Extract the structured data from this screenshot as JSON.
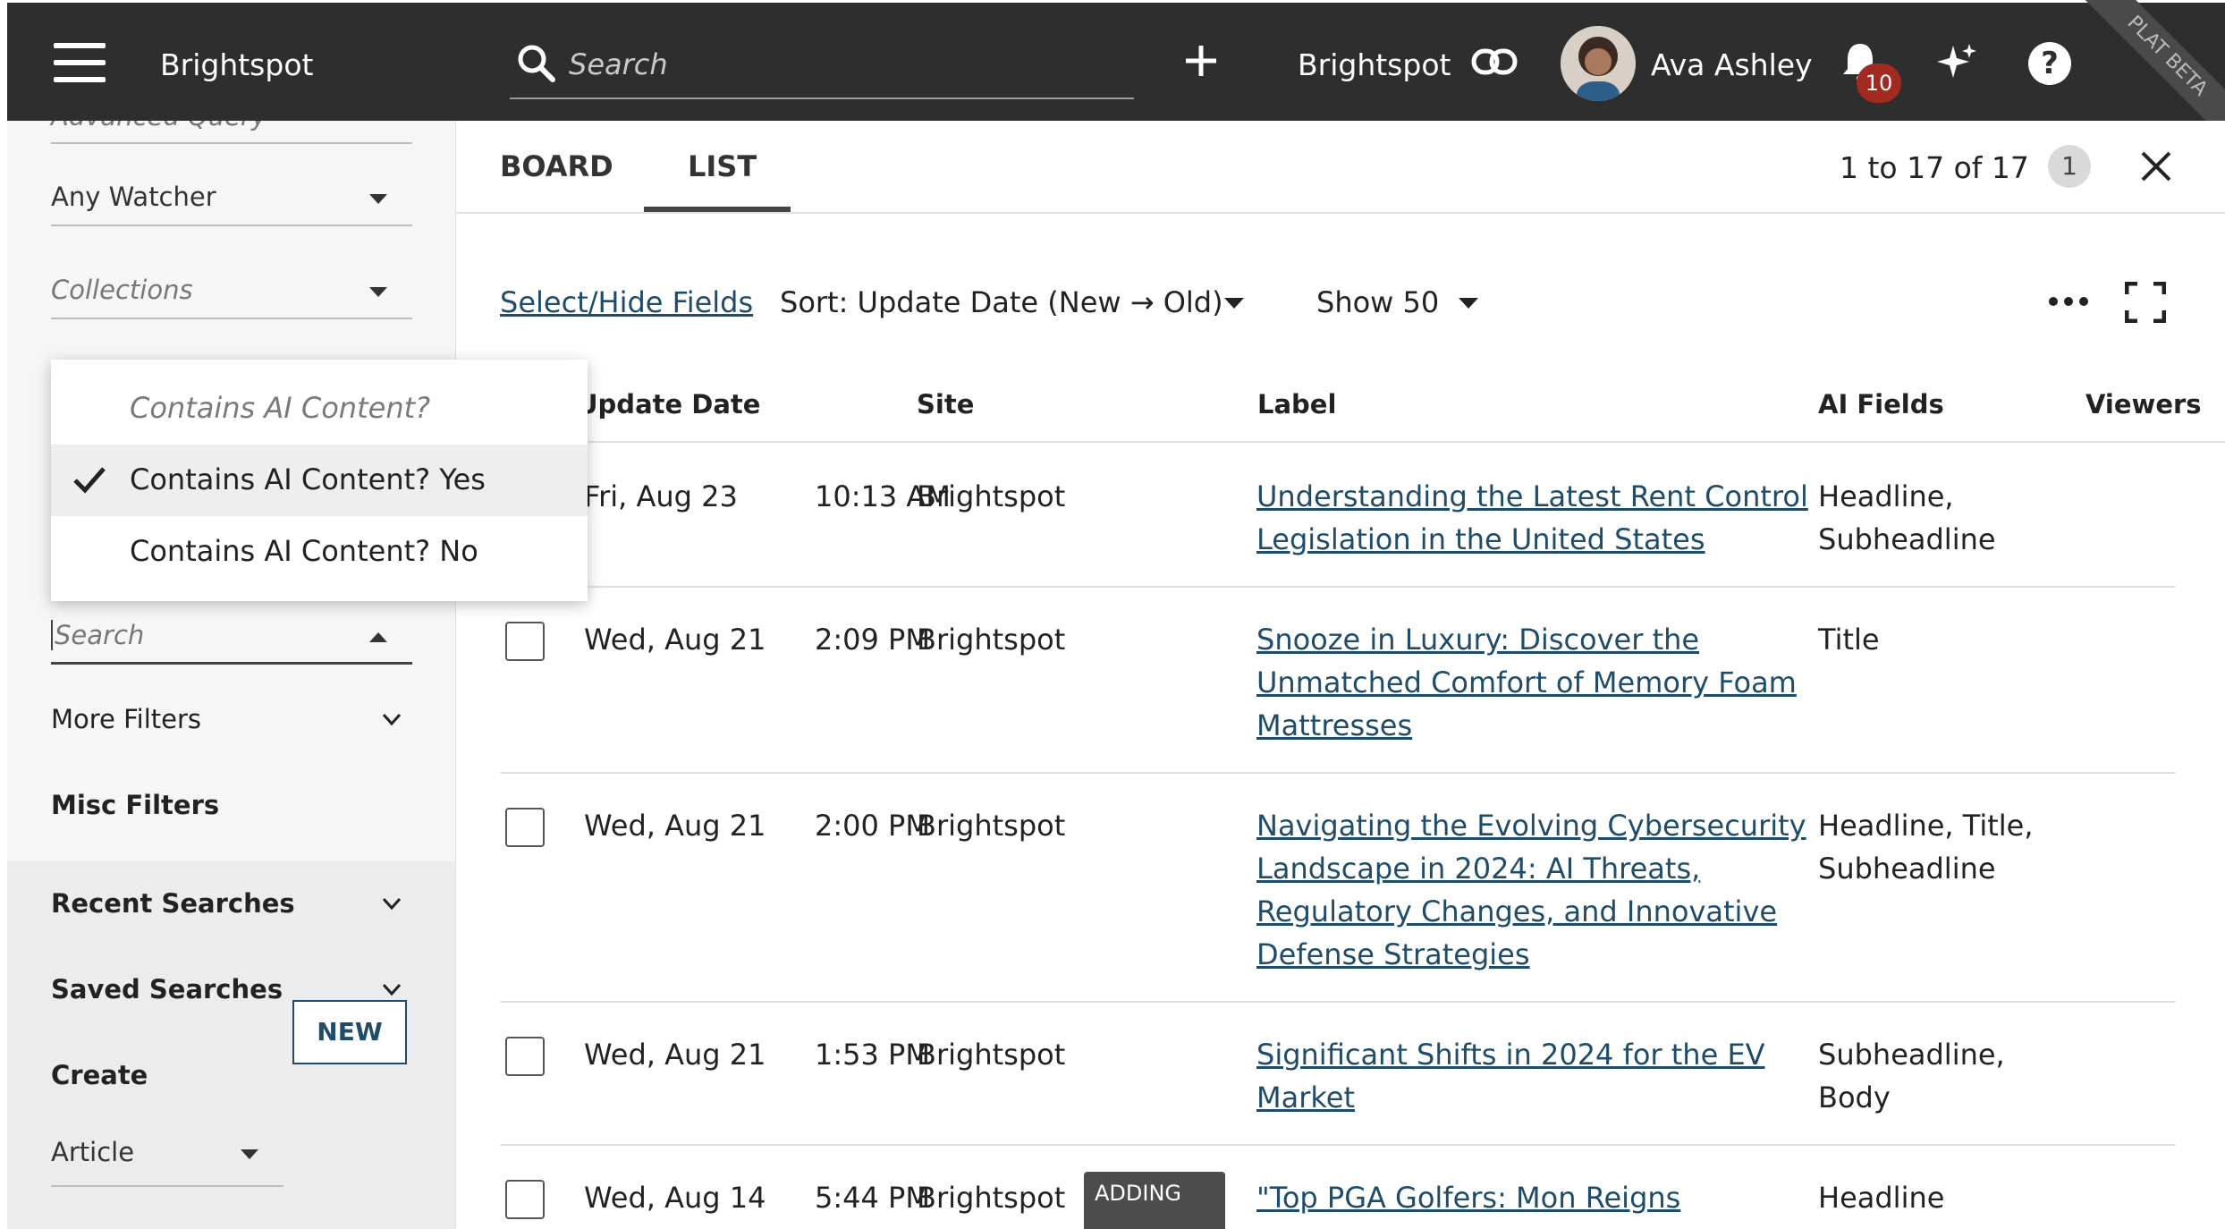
{
  "topbar": {
    "brand": "Brightspot",
    "search_placeholder": "Search",
    "site_name": "Brightspot",
    "user_name": "Ava Ashley",
    "notification_count": "10",
    "help_glyph": "?",
    "ribbon": "PLAT BETA"
  },
  "sidebar": {
    "advanced_query": "Advanced Query",
    "watcher_value": "Any Watcher",
    "collections_placeholder": "Collections",
    "search_placeholder": "Search",
    "more_filters": "More Filters",
    "misc_filters": "Misc Filters",
    "recent_searches": "Recent Searches",
    "saved_searches": "Saved Searches",
    "create_label": "Create",
    "create_type": "Article",
    "new_button": "NEW"
  },
  "popover": {
    "header": "Contains AI Content?",
    "options": [
      "Contains AI Content? Yes",
      "Contains AI Content? No"
    ],
    "selected_index": 0
  },
  "main": {
    "tabs": [
      "BOARD",
      "LIST"
    ],
    "active_tab": "LIST",
    "count_text": "1 to 17 of 17",
    "filter_badge": "1",
    "toolbar": {
      "select_hide": "Select/Hide Fields",
      "sort": "Sort: Update Date (New → Old)",
      "show": "Show 50"
    },
    "columns": [
      "Update Date",
      "Site",
      "Label",
      "AI Fields",
      "Viewers"
    ],
    "rows": [
      {
        "date": "Fri, Aug 23",
        "time": "10:13 AM",
        "site": "Brightspot",
        "label": "Understanding the Latest Rent Control Legislation in the United States",
        "label_lines": [
          "Understanding the Latest Rent Control",
          "Legislation in the United States"
        ],
        "ai_fields_lines": [
          "Headline,",
          "Subheadline"
        ]
      },
      {
        "date": "Wed, Aug 21",
        "time": "2:09 PM",
        "site": "Brightspot",
        "label_lines": [
          "Snooze in Luxury: Discover the",
          "Unmatched Comfort of Memory Foam",
          "Mattresses"
        ],
        "ai_fields_lines": [
          "Title"
        ]
      },
      {
        "date": "Wed, Aug 21",
        "time": "2:00 PM",
        "site": "Brightspot",
        "label_lines": [
          "Navigating the Evolving Cybersecurity",
          "Landscape in 2024: AI Threats,",
          "Regulatory Changes, and Innovative",
          "Defense Strategies"
        ],
        "ai_fields_lines": [
          "Headline, Title,",
          "Subheadline"
        ]
      },
      {
        "date": "Wed, Aug 21",
        "time": "1:53 PM",
        "site": "Brightspot",
        "label_lines": [
          "Significant Shifts in 2024 for the EV",
          "Market"
        ],
        "ai_fields_lines": [
          "Subheadline,",
          "Body"
        ]
      },
      {
        "date": "Wed, Aug 14",
        "time": "5:44 PM",
        "site": "Brightspot",
        "label_lines": [
          "\"Top PGA Golfers: Mon Reigns"
        ],
        "ai_fields_lines": [
          "Headline"
        ]
      }
    ],
    "adding_label": "ADDING"
  },
  "colors": {
    "topbar_bg": "#2e2e2e",
    "link": "#1f4c6a",
    "badge_red": "#a32a20"
  },
  "icons": [
    "hamburger-icon",
    "search-icon",
    "plus-icon",
    "link-icon",
    "bell-icon",
    "sparkle-icon",
    "help-icon",
    "check-icon",
    "close-icon",
    "more-icon",
    "expand-icon",
    "chevron-down-icon",
    "caret-down-icon"
  ]
}
